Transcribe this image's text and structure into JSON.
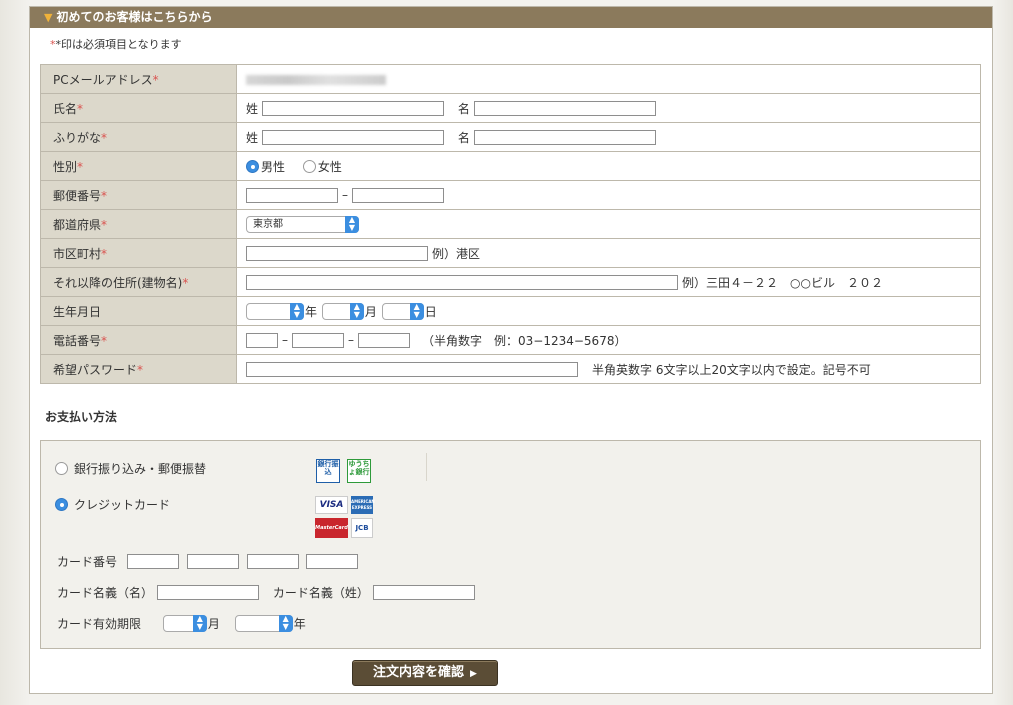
{
  "header": {
    "title": "初めてのお客様はこちらから"
  },
  "required_note": "*印は必須項目となります",
  "rows": {
    "email": {
      "label": "PCメールアドレス"
    },
    "name": {
      "label": "氏名",
      "sei": "姓",
      "mei": "名"
    },
    "furigana": {
      "label": "ふりがな",
      "sei": "姓",
      "mei": "名"
    },
    "gender": {
      "label": "性別",
      "male": "男性",
      "female": "女性"
    },
    "postal": {
      "label": "郵便番号",
      "sep": "–"
    },
    "pref": {
      "label": "都道府県",
      "value": "東京都"
    },
    "city": {
      "label": "市区町村",
      "example": "例）港区"
    },
    "address": {
      "label": "それ以降の住所(建物名)",
      "example": "例）三田４－２２　○○ビル　２０２"
    },
    "birth": {
      "label": "生年月日",
      "year": "年",
      "month": "月",
      "day": "日"
    },
    "phone": {
      "label": "電話番号",
      "sep": "–",
      "hint": "（半角数字　例：03−1234−5678）"
    },
    "password": {
      "label": "希望パスワード",
      "hint": "半角英数字 6文字以上20文字以内で設定。記号不可"
    }
  },
  "asterisk": "*",
  "payment": {
    "title": "お支払い方法",
    "bank": "銀行振り込み・郵便振替",
    "credit": "クレジットカード",
    "logos": {
      "bank": "銀行振込",
      "yucho": "ゆうちょ銀行",
      "visa": "VISA",
      "amex": "AMERICAN EXPRESS",
      "master": "MasterCard",
      "jcb": "JCB"
    },
    "card_number": "カード番号",
    "card_name_first": "カード名義（名）",
    "card_name_last": "カード名義（姓）",
    "card_expiry": "カード有効期限",
    "month": "月",
    "year": "年"
  },
  "confirm_button": "注文内容を確認"
}
